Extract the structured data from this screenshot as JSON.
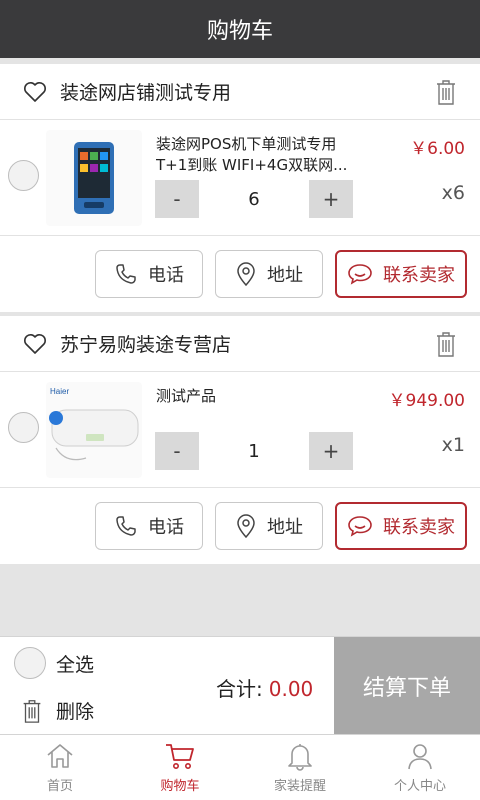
{
  "header": {
    "title": "购物车"
  },
  "shops": [
    {
      "name": "装途网店铺测试专用",
      "item": {
        "title": "装途网POS机下单测试专用T+1到账 WIFI+4G双联网...",
        "price": "￥6.00",
        "quantity": "6",
        "multiplier": "x6",
        "minus": "-",
        "plus": "+"
      },
      "actions": {
        "phone": "电话",
        "address": "地址",
        "contact": "联系卖家"
      }
    },
    {
      "name": "苏宁易购装途专营店",
      "item": {
        "title": "测试产品",
        "price": "￥949.00",
        "quantity": "1",
        "multiplier": "x1",
        "minus": "-",
        "plus": "+"
      },
      "actions": {
        "phone": "电话",
        "address": "地址",
        "contact": "联系卖家"
      }
    }
  ],
  "footer": {
    "select_all": "全选",
    "delete": "删除",
    "total_label": "合计:",
    "total_amount": "0.00",
    "checkout": "结算下单"
  },
  "tabs": [
    {
      "label": "首页",
      "icon": "home-icon"
    },
    {
      "label": "购物车",
      "icon": "cart-icon",
      "active": true
    },
    {
      "label": "家装提醒",
      "icon": "bell-icon"
    },
    {
      "label": "个人中心",
      "icon": "user-icon"
    }
  ],
  "colors": {
    "accent": "#c0262d",
    "titlebar": "#3a3a3c",
    "checkout_bg": "#a8a8a8"
  }
}
